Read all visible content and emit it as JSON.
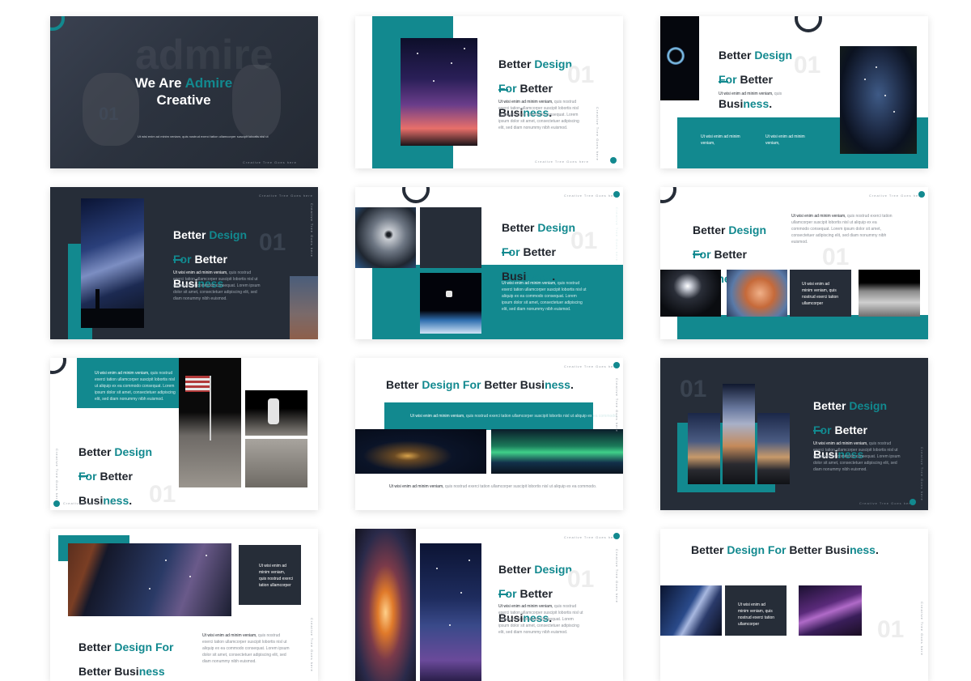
{
  "cover": {
    "line1": "We Are",
    "accent": "Admire",
    "line2": "Creative",
    "watermark": "admire",
    "number": "01",
    "caption": "Ut wisi enim ad minim veniam, quis nostrud exerci tation ullamcorper suscipit lobortis nisl ut"
  },
  "title": {
    "w1": "Better ",
    "w2": "Design",
    "w3": "For",
    "w4": " Better",
    "w5": "Busi",
    "w6": "ness",
    "w7": "."
  },
  "oneline": {
    "a": "Better ",
    "b": "Design For",
    "c": " Better Busi",
    "d": "ness",
    "e": "."
  },
  "number": "01",
  "body_lead": "Ut wisi enim ad minim veniam,",
  "body_rest": " quis nostrud exerci tation ullamcorper suscipit lobortis nisl ut aliquip ex ea commodo consequat. Lorem ipsum dolor sit amet, consectetuer adipiscing elit, sed diam nonummy nibh euismod.",
  "short_lead": "Ut wisi enim ad minim veniam,",
  "short_rest": " quis",
  "wide_lead": "Ut wisi enim ad minim veniam,",
  "wide_rest": " quis nostrud exerci tation ullamcorper suscipit lobortis nisl ut aliquip ex ea commodo.",
  "box_text": "Ut wisi enim ad minim veniam, quis nostrud exerci tation ullamcorper",
  "footer": "Creative Tree Goes here",
  "colors": {
    "teal": "#12898f",
    "navy": "#262d38"
  }
}
